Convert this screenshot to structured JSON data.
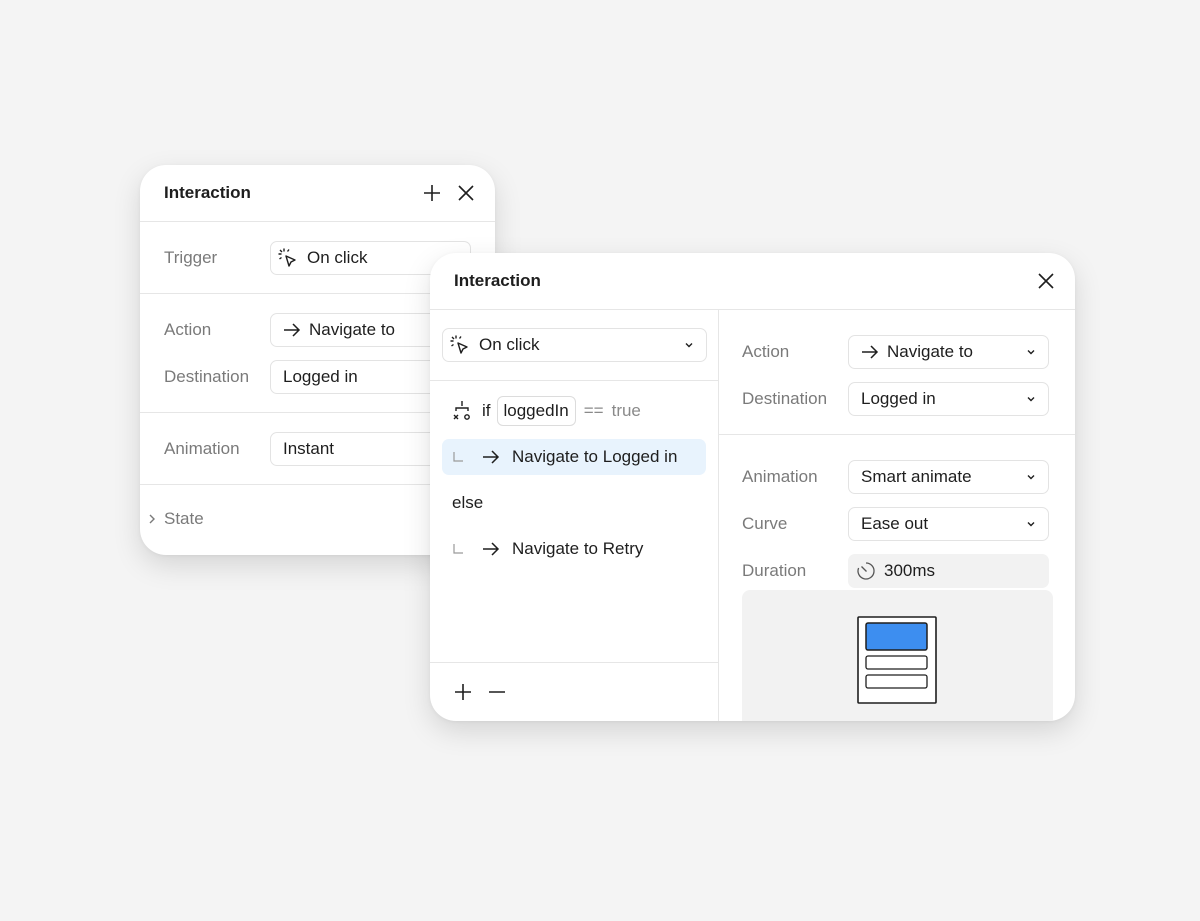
{
  "back_panel": {
    "title": "Interaction",
    "trigger_label": "Trigger",
    "trigger_value": "On click",
    "action_label": "Action",
    "action_value": "Navigate to",
    "destination_label": "Destination",
    "destination_value": "Logged in",
    "animation_label": "Animation",
    "animation_value": "Instant",
    "state_label": "State"
  },
  "front_panel": {
    "title": "Interaction",
    "trigger_value": "On click",
    "logic": {
      "if_keyword": "if",
      "variable": "loggedIn",
      "operator": "==",
      "compare_value": "true",
      "then_action": "Navigate to",
      "then_destination": "Logged in",
      "else_keyword": "else",
      "else_action": "Navigate to",
      "else_destination": "Retry"
    },
    "action_label": "Action",
    "action_value": "Navigate to",
    "destination_label": "Destination",
    "destination_value": "Logged in",
    "animation_label": "Animation",
    "animation_value": "Smart animate",
    "curve_label": "Curve",
    "curve_value": "Ease out",
    "duration_label": "Duration",
    "duration_value": "300ms"
  },
  "colors": {
    "background": "#f4f4f4",
    "highlight": "#e8f3fd",
    "preview_accent": "#3d8ef0",
    "muted_text": "#7a7a7a"
  },
  "icons": {
    "add": "plus-icon",
    "close": "close-icon",
    "trigger": "click-cursor-icon",
    "action": "arrow-right-icon",
    "dropdown": "chevron-down-icon",
    "branch": "conditional-branch-icon",
    "duration": "timer-icon",
    "remove": "minus-icon",
    "expand": "chevron-right-icon"
  }
}
